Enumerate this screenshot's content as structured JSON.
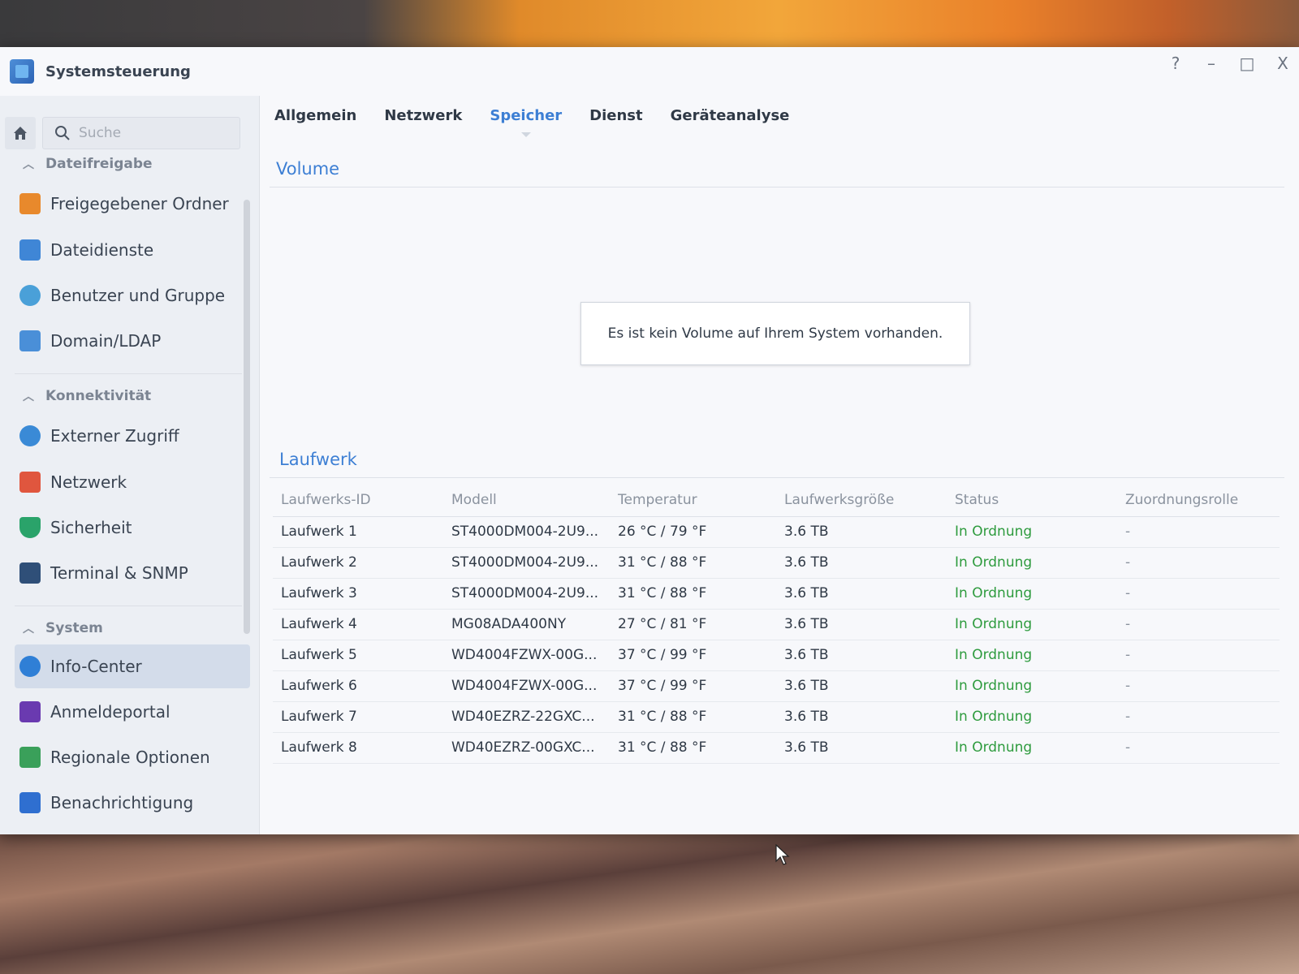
{
  "window": {
    "title": "Systemsteuerung",
    "controls": [
      "?",
      "–",
      "□",
      "X"
    ]
  },
  "sidebar": {
    "search_placeholder": "Suche",
    "sections": [
      {
        "label": "Dateifreigabe",
        "items": [
          {
            "label": "Freigegebener Ordner",
            "icon": "folder-share-icon",
            "color": "#e8892c"
          },
          {
            "label": "Dateidienste",
            "icon": "file-services-icon",
            "color": "#3f86d6"
          },
          {
            "label": "Benutzer und Gruppe",
            "icon": "users-icon",
            "color": "#4aa0d8"
          },
          {
            "label": "Domain/LDAP",
            "icon": "domain-icon",
            "color": "#4a8fd8"
          }
        ]
      },
      {
        "label": "Konnektivität",
        "items": [
          {
            "label": "Externer Zugriff",
            "icon": "external-access-icon",
            "color": "#3a8ad6"
          },
          {
            "label": "Netzwerk",
            "icon": "network-icon",
            "color": "#e0563e"
          },
          {
            "label": "Sicherheit",
            "icon": "shield-icon",
            "color": "#2aa36a"
          },
          {
            "label": "Terminal & SNMP",
            "icon": "terminal-icon",
            "color": "#2f4f78"
          }
        ]
      },
      {
        "label": "System",
        "items": [
          {
            "label": "Info-Center",
            "icon": "info-icon",
            "color": "#2f7fd6",
            "active": true
          },
          {
            "label": "Anmeldeportal",
            "icon": "login-portal-icon",
            "color": "#6a3ab0"
          },
          {
            "label": "Regionale Optionen",
            "icon": "regional-options-icon",
            "color": "#3aa05a"
          },
          {
            "label": "Benachrichtigung",
            "icon": "notification-icon",
            "color": "#2f6fd0"
          }
        ]
      }
    ]
  },
  "tabs": [
    {
      "label": "Allgemein"
    },
    {
      "label": "Netzwerk"
    },
    {
      "label": "Speicher",
      "active": true
    },
    {
      "label": "Dienst"
    },
    {
      "label": "Geräteanalyse"
    }
  ],
  "volume": {
    "title": "Volume",
    "empty_message": "Es ist kein Volume auf Ihrem System vorhanden."
  },
  "drives": {
    "title": "Laufwerk",
    "columns": [
      "Laufwerks-ID",
      "Modell",
      "Temperatur",
      "Laufwerksgröße",
      "Status",
      "Zuordnungsrolle"
    ],
    "rows": [
      {
        "id": "Laufwerk 1",
        "model": "ST4000DM004-2U9...",
        "temp": "26 °C / 79 °F",
        "size": "3.6 TB",
        "status": "In Ordnung",
        "role": "-"
      },
      {
        "id": "Laufwerk 2",
        "model": "ST4000DM004-2U9...",
        "temp": "31 °C / 88 °F",
        "size": "3.6 TB",
        "status": "In Ordnung",
        "role": "-"
      },
      {
        "id": "Laufwerk 3",
        "model": "ST4000DM004-2U9...",
        "temp": "31 °C / 88 °F",
        "size": "3.6 TB",
        "status": "In Ordnung",
        "role": "-"
      },
      {
        "id": "Laufwerk 4",
        "model": "MG08ADA400NY",
        "temp": "27 °C / 81 °F",
        "size": "3.6 TB",
        "status": "In Ordnung",
        "role": "-"
      },
      {
        "id": "Laufwerk 5",
        "model": "WD4004FZWX-00G...",
        "temp": "37 °C / 99 °F",
        "size": "3.6 TB",
        "status": "In Ordnung",
        "role": "-"
      },
      {
        "id": "Laufwerk 6",
        "model": "WD4004FZWX-00G...",
        "temp": "37 °C / 99 °F",
        "size": "3.6 TB",
        "status": "In Ordnung",
        "role": "-"
      },
      {
        "id": "Laufwerk 7",
        "model": "WD40EZRZ-22GXC...",
        "temp": "31 °C / 88 °F",
        "size": "3.6 TB",
        "status": "In Ordnung",
        "role": "-"
      },
      {
        "id": "Laufwerk 8",
        "model": "WD40EZRZ-00GXC...",
        "temp": "31 °C / 88 °F",
        "size": "3.6 TB",
        "status": "In Ordnung",
        "role": "-"
      }
    ]
  },
  "colors": {
    "accent": "#3d7fd4",
    "status_ok": "#2e9b3e"
  }
}
